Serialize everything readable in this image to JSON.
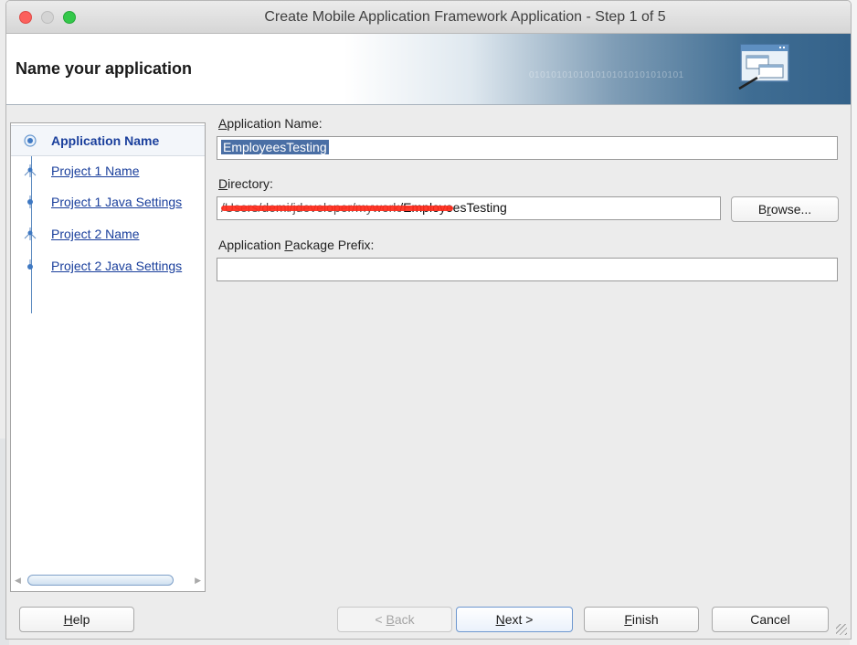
{
  "window": {
    "title": "Create Mobile Application Framework Application - Step 1 of 5"
  },
  "banner": {
    "title": "Name your application",
    "binary": "0101010101010101010101010101"
  },
  "steps": [
    {
      "label": "Application Name",
      "active": true
    },
    {
      "label": "Project 1 Name",
      "active": false
    },
    {
      "label": "Project 1 Java Settings",
      "active": false
    },
    {
      "label": "Project 2 Name",
      "active": false
    },
    {
      "label": "Project 2 Java Settings",
      "active": false
    }
  ],
  "form": {
    "app_name_label_mn": "A",
    "app_name_label_rest": "pplication Name:",
    "app_name_value": "EmployeesTesting",
    "directory_label_mn": "D",
    "directory_label_rest": "irectory:",
    "directory_value_redacted": "/Users/demi/jdeveloper/mywork",
    "directory_value_visible": "/EmployeesTesting",
    "browse_label_pre": "B",
    "browse_label_mn": "r",
    "browse_label_post": "owse...",
    "prefix_label_pre": "Application ",
    "prefix_label_mn": "P",
    "prefix_label_post": "ackage Prefix:",
    "prefix_value": ""
  },
  "buttons": {
    "help_mn": "H",
    "help_rest": "elp",
    "back_pre": "< ",
    "back_mn": "B",
    "back_post": "ack",
    "next_mn": "N",
    "next_post": "ext >",
    "finish_mn": "F",
    "finish_post": "inish",
    "cancel": "Cancel"
  },
  "colors": {
    "link": "#1a3f9c",
    "selection": "#4a6fa5",
    "redaction": "#ff2a1a",
    "banner_dark": "#34628a"
  }
}
